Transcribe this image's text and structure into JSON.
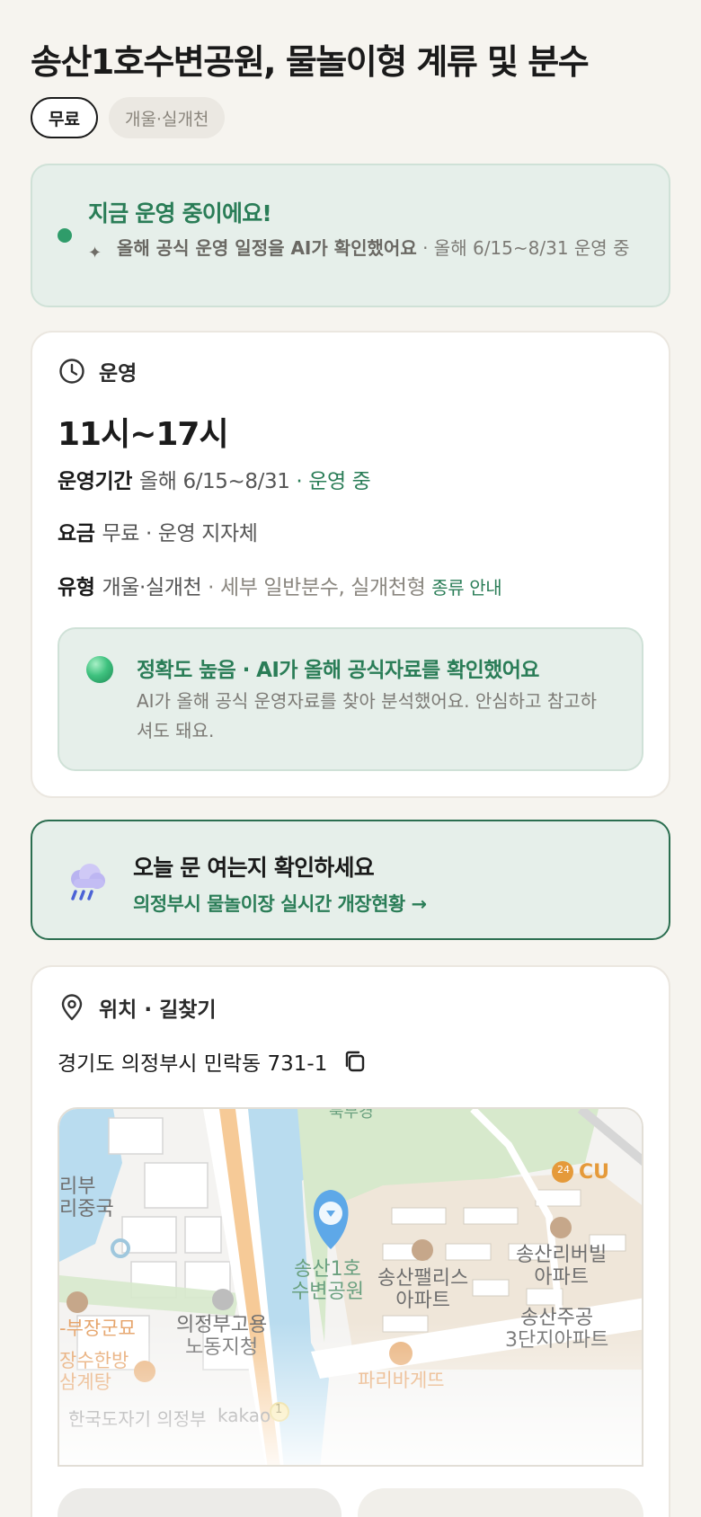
{
  "header": {
    "title": "송산1호수변공원, 물놀이형 계류 및 분수",
    "chips": {
      "fee": "무료",
      "type": "개울·실개천"
    }
  },
  "status": {
    "title": "지금 운영 중이에요!",
    "ai_check": "올해 공식 운영 일정을 AI가 확인했어요",
    "detail": "· 올해 6/15~8/31 운영 중"
  },
  "operation": {
    "section_label": "운영",
    "hours": "11시~17시",
    "period_key": "운영기간",
    "period_value": "올해 6/15~8/31",
    "period_status": "· 운영 중",
    "fee_key": "요금",
    "fee_value": "무료 · 운영 지자체",
    "type_key": "유형",
    "type_value": "개울·실개천",
    "type_detail": "· 세부 일반분수, 실개천형",
    "type_link": "종류 안내",
    "accuracy_title": "정확도 높음 · AI가 올해 공식자료를 확인했어요",
    "accuracy_desc": "AI가 올해 공식 운영자료를 찾아 분석했어요. 안심하고 참고하셔도 돼요."
  },
  "open_check": {
    "title": "오늘 문 여는지 확인하세요",
    "link": "의정부시 물놀이장 실시간 개장현황 →"
  },
  "location": {
    "section_label": "위치 · 길찾기",
    "address": "경기도 의정부시 민락동 731-1"
  },
  "map": {
    "labels": {
      "top_partial": "북부경",
      "left_partial": "리부\n리중국",
      "park": "송산1호\n수변공원",
      "palace": "송산팰리스\n아파트",
      "riverville": "송산리버빌\n아파트",
      "jugong": "송산주공\n3단지아파트",
      "military": "-부장군묘",
      "labor": "의정부고용\n노동지청",
      "samgyetang": "장수한방\n삼계탕",
      "paris": "파리바게뜨",
      "cu": "CU",
      "bottom_left": "한국도자기 의정부",
      "kakao": "kakao",
      "route": "1",
      "store_24": "24"
    },
    "colors": {
      "water": "#b9dcef",
      "park": "#d7e9cc",
      "road_orange": "#f2b36b",
      "pin": "#5ea8e8",
      "apartment": "#efe6d9"
    }
  }
}
